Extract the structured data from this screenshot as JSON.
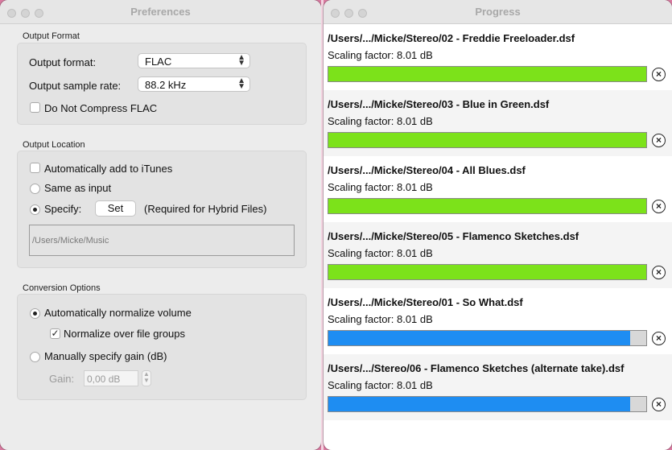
{
  "preferences": {
    "title": "Preferences",
    "output_format_section": "Output Format",
    "output_format_label": "Output format:",
    "output_format_value": "FLAC",
    "sample_rate_label": "Output sample rate:",
    "sample_rate_value": "88.2 kHz",
    "do_not_compress_label": "Do Not Compress FLAC",
    "do_not_compress_checked": false,
    "output_location_section": "Output Location",
    "add_to_itunes_label": "Automatically add to iTunes",
    "add_to_itunes_checked": false,
    "same_as_input_label": "Same as input",
    "specify_label": "Specify:",
    "set_button": "Set",
    "hybrid_note": "(Required for Hybrid Files)",
    "path_value": "/Users/Micke/Music",
    "conversion_section": "Conversion Options",
    "auto_normalize_label": "Automatically normalize volume",
    "normalize_groups_label": "Normalize over file groups",
    "normalize_groups_check": "✓",
    "manual_gain_label": "Manually specify gain (dB)",
    "gain_label": "Gain:",
    "gain_value": "0,00 dB"
  },
  "progress": {
    "title": "Progress",
    "items": [
      {
        "file": "/Users/.../Micke/Stereo/02 - Freddie Freeloader.dsf",
        "scaling": "Scaling factor: 8.01 dB",
        "progress": 1.0,
        "color": "#7ce21a"
      },
      {
        "file": "/Users/.../Micke/Stereo/03 - Blue in Green.dsf",
        "scaling": "Scaling factor: 8.01 dB",
        "progress": 1.0,
        "color": "#7ce21a"
      },
      {
        "file": "/Users/.../Micke/Stereo/04 - All Blues.dsf",
        "scaling": "Scaling factor: 8.01 dB",
        "progress": 1.0,
        "color": "#7ce21a"
      },
      {
        "file": "/Users/.../Micke/Stereo/05 - Flamenco Sketches.dsf",
        "scaling": "Scaling factor: 8.01 dB",
        "progress": 1.0,
        "color": "#7ce21a"
      },
      {
        "file": "/Users/.../Micke/Stereo/01 - So What.dsf",
        "scaling": "Scaling factor: 8.01 dB",
        "progress": 0.95,
        "color": "#1e8df2"
      },
      {
        "file": "/Users/.../Stereo/06 - Flamenco Sketches (alternate take).dsf",
        "scaling": "Scaling factor: 8.01 dB",
        "progress": 0.95,
        "color": "#1e8df2"
      }
    ],
    "cancel_glyph": "×"
  },
  "colors": {
    "complete": "#7ce21a",
    "in_progress": "#1e8df2",
    "desktop": "#d97aa0"
  }
}
